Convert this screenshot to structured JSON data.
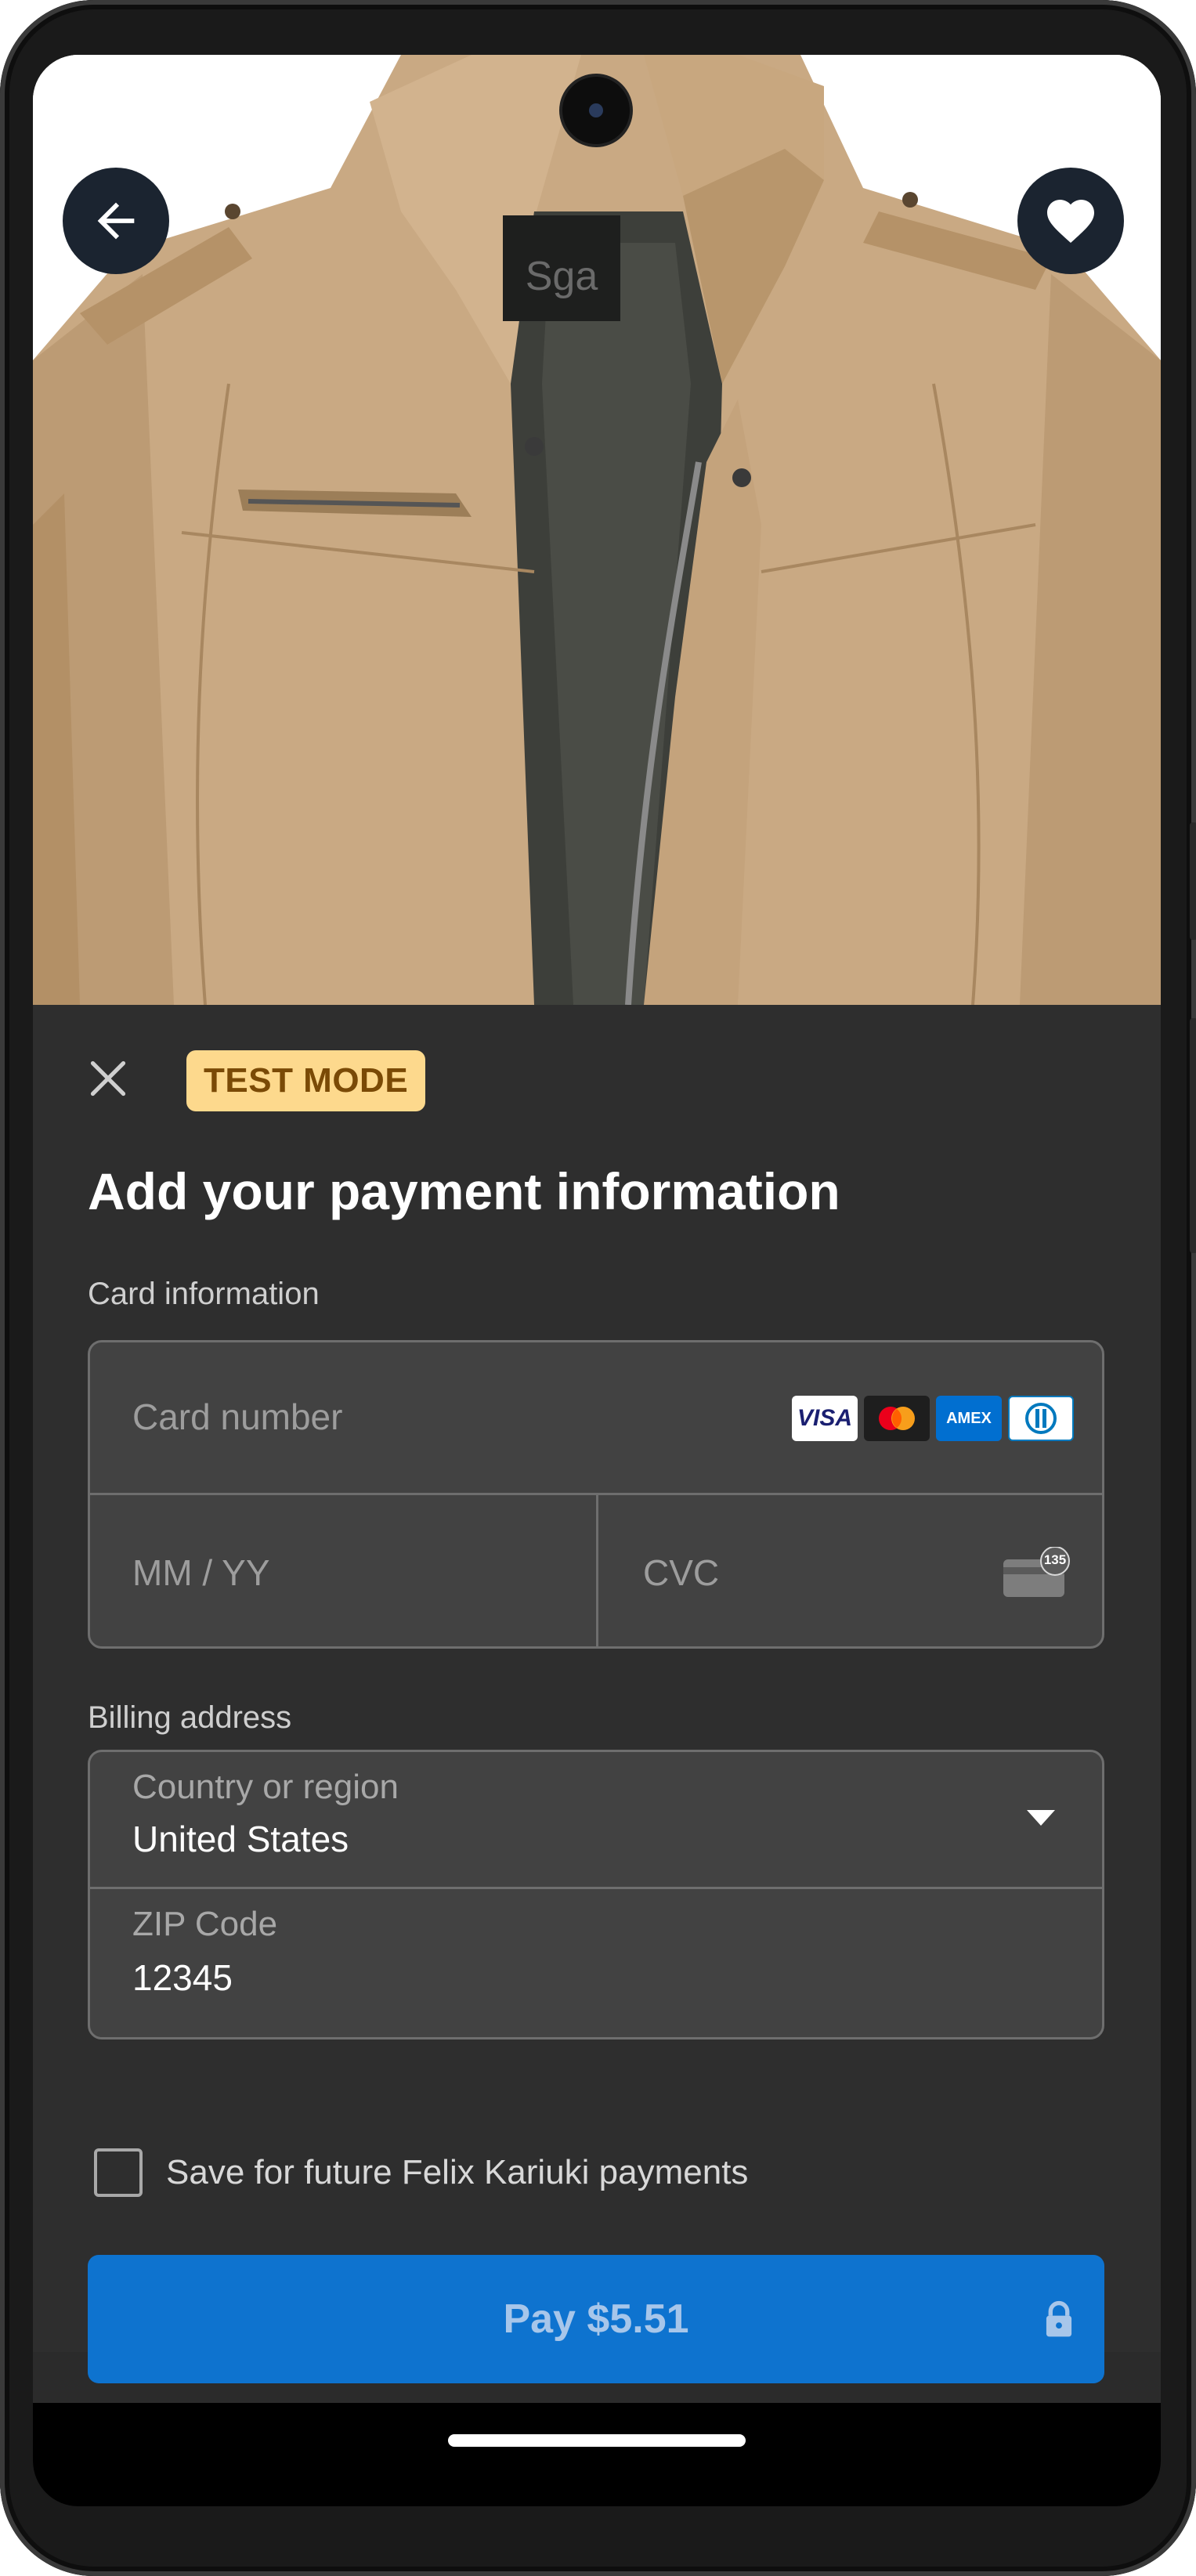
{
  "product": {
    "image_alt": "Khaki zip-up jacket",
    "image_brand_text": "Sga"
  },
  "top_actions": {
    "back_icon": "arrow-left-icon",
    "favorite_icon": "heart-icon"
  },
  "sheet": {
    "close_icon": "close-icon",
    "badge": "TEST MODE",
    "title": "Add your payment information",
    "card_section_label": "Card information",
    "card_number_placeholder": "Card number",
    "expiry_placeholder": "MM / YY",
    "cvc_placeholder": "CVC",
    "cvc_hint_number": "135",
    "card_brands": [
      "VISA",
      "Mastercard",
      "AMEX",
      "Diners Club"
    ],
    "billing_section_label": "Billing address",
    "country_label": "Country or region",
    "country_value": "United States",
    "zip_label": "ZIP Code",
    "zip_value": "12345",
    "save_label": "Save for future Felix Kariuki payments",
    "pay_label": "Pay $5.51"
  },
  "colors": {
    "sheet_bg": "#2e2e2e",
    "field_bg": "#424242",
    "badge_bg": "#fdd98d",
    "pay_button": "#0e73cf",
    "icon_button_bg": "#1b2430"
  }
}
